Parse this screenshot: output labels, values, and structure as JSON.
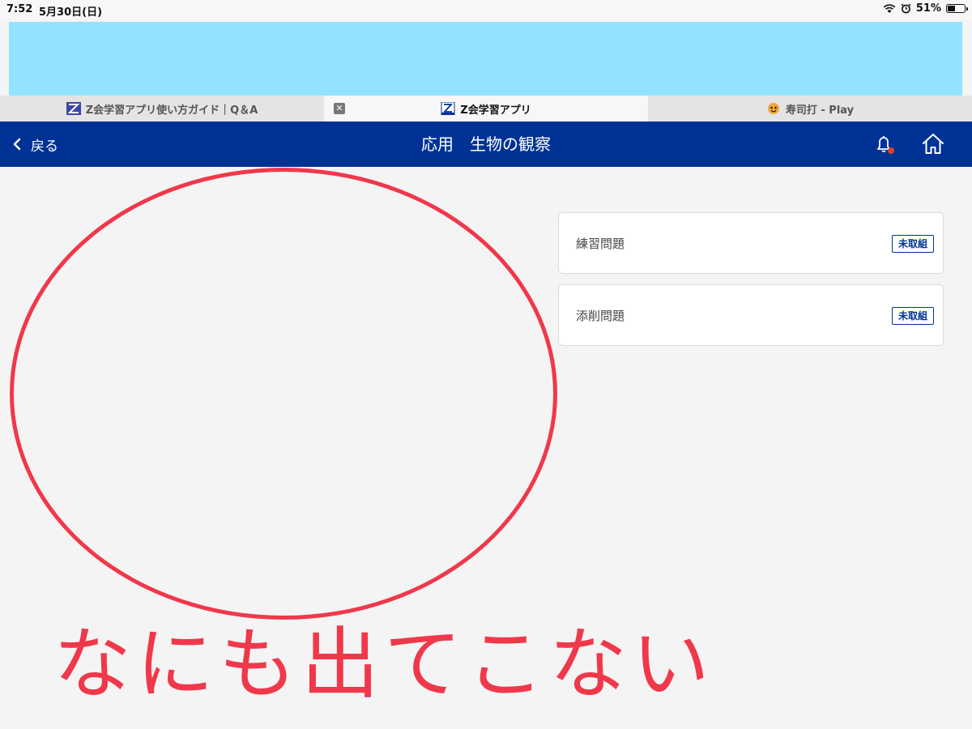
{
  "status_bar": {
    "time": "7:52",
    "date": "5月30日(日)",
    "battery": "51%",
    "battery_level": 0.51,
    "icons": [
      "wifi-icon",
      "alarm-icon",
      "battery-icon"
    ]
  },
  "tabs": [
    {
      "label": "Z会学習アプリ使い方ガイド｜Q＆A",
      "active": false,
      "icon": "zkai-guide-favicon"
    },
    {
      "label": "Z会学習アプリ",
      "active": true,
      "icon": "zkai-app-favicon"
    },
    {
      "label": "寿司打 - Play",
      "active": false,
      "icon": "sushida-favicon"
    }
  ],
  "header": {
    "back_label": "戻る",
    "title": "応用　生物の観察",
    "icons": [
      "chevron-left-icon",
      "bell-icon",
      "home-icon"
    ]
  },
  "cards": [
    {
      "label": "練習問題",
      "badge": "未取組"
    },
    {
      "label": "添削問題",
      "badge": "未取組"
    }
  ],
  "annotation": {
    "text": "なにも出てこない"
  },
  "colors": {
    "header_bg": "#003296",
    "annotation": "#f0384b",
    "redaction": "#92e3ff",
    "page_bg": "#f4f4f4",
    "notification_dot": "#e0401c"
  }
}
